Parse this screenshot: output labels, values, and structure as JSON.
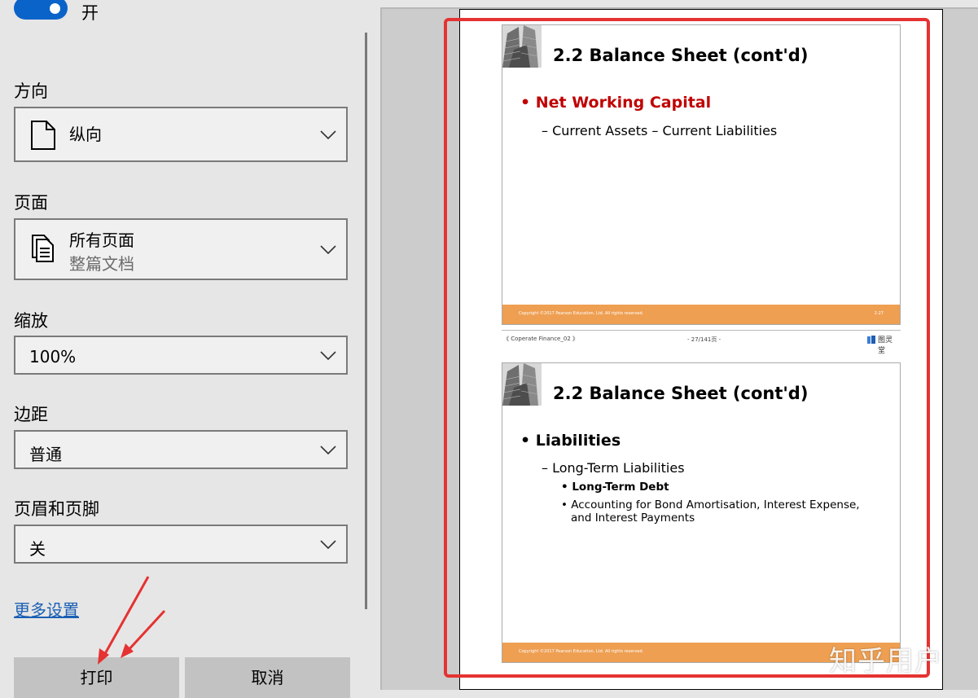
{
  "colors": {
    "accent_blue": "#0a63c9",
    "link_blue": "#1a5fb4",
    "slide_footer_orange": "#ee9f52",
    "slide_title_red": "#c00000",
    "annotation_red": "#e53232"
  },
  "toggle": {
    "label": "开",
    "state": "on"
  },
  "orientation": {
    "label": "方向",
    "value": "纵向",
    "icon": "page-portrait-icon"
  },
  "pages": {
    "label": "页面",
    "value": "所有页面",
    "sub": "整篇文档",
    "icon": "pages-stack-icon"
  },
  "scale": {
    "label": "缩放",
    "value": "100%"
  },
  "margins": {
    "label": "边距",
    "value": "普通"
  },
  "header_footer": {
    "label": "页眉和页脚",
    "value": "关"
  },
  "more_settings": "更多设置",
  "buttons": {
    "print": "打印",
    "cancel": "取消"
  },
  "preview": {
    "slide1": {
      "title": "2.2 Balance Sheet (cont'd)",
      "bullet": "• Net Working Capital",
      "sub": "– Current Assets – Current Liabilities",
      "copyright": "Copyright ©2017 Pearson Education, Ltd. All rights reserved.",
      "page": "2-27"
    },
    "nav": {
      "left": "《 Coperate Finance_02 》",
      "center": "- 27/141页 -",
      "logo": "图灵堂"
    },
    "slide2": {
      "title": "2.2 Balance Sheet (cont'd)",
      "bullet": "• Liabilities",
      "sub": "– Long-Term Liabilities",
      "item1": "• Long-Term Debt",
      "item2": "• Accounting for Bond Amortisation, Interest Expense,",
      "item2_cont": "and Interest Payments",
      "copyright": "Copyright ©2017 Pearson Education, Ltd. All rights reserved."
    }
  },
  "watermark": "知乎用户"
}
